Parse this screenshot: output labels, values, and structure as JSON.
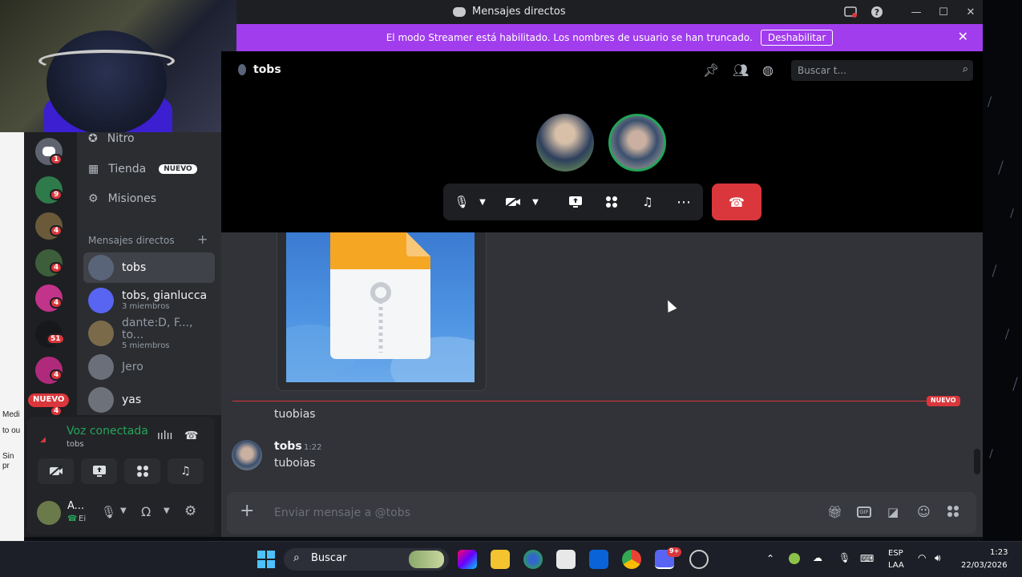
{
  "window": {
    "title": "Mensajes directos"
  },
  "banner": {
    "text": "El modo Streamer está habilitado. Los nombres de usuario se han truncado.",
    "button": "Deshabilitar"
  },
  "desktop_left": {
    "lines": [
      "Medi",
      "to ou",
      "Sin",
      "pr"
    ]
  },
  "servers": {
    "badges": [
      "1",
      "9",
      "4",
      "4",
      "4",
      "51",
      "4",
      "4"
    ],
    "new_label": "NUEVO"
  },
  "dm_sidebar": {
    "nitro": "Nitro",
    "shop": "Tienda",
    "shop_tag": "NUEVO",
    "missions": "Misiones",
    "section": "Mensajes directos",
    "add": "+",
    "items": [
      {
        "name": "tobs",
        "sub": ""
      },
      {
        "name": "tobs, gianlucca",
        "sub": "3 miembros"
      },
      {
        "name": "dante:D, F..., to...",
        "sub": "5 miembros"
      },
      {
        "name": "Jero",
        "sub": ""
      },
      {
        "name": "yas",
        "sub": ""
      }
    ]
  },
  "voice": {
    "status": "Voz conectada",
    "channel": "tobs"
  },
  "user_panel": {
    "name": "A...",
    "status": "Ei"
  },
  "call": {
    "channel_name": "tobs",
    "search_placeholder": "Buscar t..."
  },
  "chat": {
    "new_label": "NUEVO",
    "orphan_line": "tuobias",
    "message": {
      "author": "tobs",
      "time": "1:22",
      "text": "tuboias"
    },
    "input_placeholder": "Enviar mensaje a @tobs"
  },
  "taskbar": {
    "search": "Buscar",
    "lang1": "ESP",
    "lang2": "LAA",
    "time": "1:23",
    "date": "22/03/2026",
    "discord_badge": "9+"
  },
  "colors": {
    "streamer_banner": "#a13ded",
    "danger": "#da373c",
    "voice_green": "#23a55a",
    "accent": "#5865f2"
  }
}
